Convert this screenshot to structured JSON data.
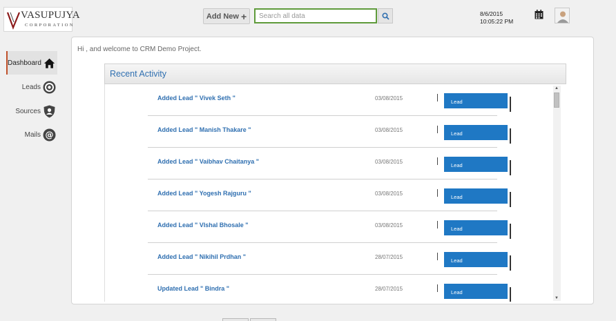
{
  "header": {
    "logo_name": "VASUPUJYA",
    "logo_sub": "CORPORATION",
    "add_new_label": "Add New",
    "search_placeholder": "Search all data",
    "date": "8/6/2015",
    "time": "10:05:22 PM"
  },
  "sidebar": {
    "items": [
      {
        "label": "Dashboard",
        "icon": "home-icon",
        "active": true
      },
      {
        "label": "Leads",
        "icon": "target-icon"
      },
      {
        "label": "Sources",
        "icon": "shield-user-icon"
      },
      {
        "label": "Mails",
        "icon": "at-sign-icon"
      }
    ]
  },
  "main": {
    "welcome": "Hi , and welcome to CRM Demo Project.",
    "panel_title": "Recent Activity",
    "activities": [
      {
        "title": "Added Lead \" Vivek Seth \"",
        "date": "03/08/2015",
        "tag": "Lead"
      },
      {
        "title": "Added Lead \" Manish Thakare \"",
        "date": "03/08/2015",
        "tag": "Lead"
      },
      {
        "title": "Added Lead \" Vaibhav Chaitanya \"",
        "date": "03/08/2015",
        "tag": "Lead"
      },
      {
        "title": "Added Lead \" Yogesh Rajguru \"",
        "date": "03/08/2015",
        "tag": "Lead"
      },
      {
        "title": "Added Lead \" VIshal Bhosale \"",
        "date": "03/08/2015",
        "tag": "Lead"
      },
      {
        "title": "Added Lead \" Nikihil Prdhan \"",
        "date": "28/07/2015",
        "tag": "Lead"
      },
      {
        "title": "Updated Lead \" Bindra \"",
        "date": "28/07/2015",
        "tag": "Lead"
      }
    ]
  },
  "colors": {
    "accent": "#1f78c4",
    "title_blue": "#2f6fb0",
    "search_border": "#5e9a3a",
    "active_indicator": "#c0502a"
  }
}
